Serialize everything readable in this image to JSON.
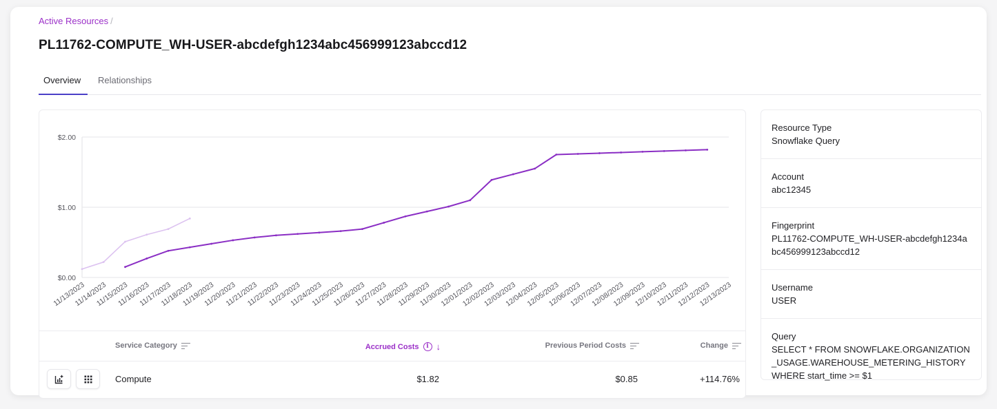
{
  "breadcrumb": {
    "parent": "Active Resources",
    "separator": "/"
  },
  "page_title": "PL11762-COMPUTE_WH-USER-abcdefgh1234abc456999123abccd12",
  "tabs": [
    {
      "label": "Overview",
      "active": true
    },
    {
      "label": "Relationships",
      "active": false
    }
  ],
  "colors": {
    "accent": "#9b30c8",
    "current_series": "#8a2ec4",
    "previous_series": "#dcc2f0",
    "tab_underline": "#4a3fc7"
  },
  "chart_data": {
    "type": "line",
    "title": "",
    "xlabel": "",
    "ylabel": "",
    "ylim": [
      0,
      2
    ],
    "yticks": [
      "$0.00",
      "$1.00",
      "$2.00"
    ],
    "ytick_values": [
      0,
      1,
      2
    ],
    "grid": true,
    "x": [
      "11/13/2023",
      "11/14/2023",
      "11/15/2023",
      "11/16/2023",
      "11/17/2023",
      "11/18/2023",
      "11/19/2023",
      "11/20/2023",
      "11/21/2023",
      "11/22/2023",
      "11/23/2023",
      "11/24/2023",
      "11/25/2023",
      "11/26/2023",
      "11/27/2023",
      "11/28/2023",
      "11/29/2023",
      "11/30/2023",
      "12/01/2023",
      "12/02/2023",
      "12/03/2023",
      "12/04/2023",
      "12/05/2023",
      "12/06/2023",
      "12/07/2023",
      "12/08/2023",
      "12/09/2023",
      "12/10/2023",
      "12/11/2023",
      "12/12/2023",
      "12/13/2023"
    ],
    "series": [
      {
        "name": "Previous Period Costs",
        "values": [
          0.12,
          0.22,
          0.51,
          0.61,
          0.69,
          0.84,
          null,
          null,
          null,
          null,
          null,
          null,
          null,
          null,
          null,
          null,
          null,
          null,
          null,
          null,
          null,
          null,
          null,
          null,
          null,
          null,
          null,
          null,
          null,
          null,
          null
        ]
      },
      {
        "name": "Accrued Costs",
        "values": [
          null,
          null,
          0.15,
          0.27,
          0.38,
          0.43,
          0.48,
          0.53,
          0.57,
          0.6,
          0.62,
          0.64,
          0.66,
          0.69,
          0.78,
          0.87,
          0.94,
          1.01,
          1.1,
          1.39,
          1.47,
          1.55,
          1.75,
          1.76,
          1.77,
          1.78,
          1.79,
          1.8,
          1.81,
          1.82,
          null
        ]
      }
    ]
  },
  "table": {
    "columns": [
      {
        "label": "Service Category",
        "sortable": true
      },
      {
        "label": "Accrued Costs",
        "sortable": true,
        "sorted": "desc",
        "info": true
      },
      {
        "label": "Previous Period Costs",
        "sortable": true
      },
      {
        "label": "Change",
        "sortable": true
      }
    ],
    "rows": [
      {
        "service": "Compute",
        "accrued": "$1.82",
        "previous": "$0.85",
        "change": "+114.76%"
      }
    ]
  },
  "details": [
    {
      "label": "Resource Type",
      "value": "Snowflake Query"
    },
    {
      "label": "Account",
      "value": "abc12345"
    },
    {
      "label": "Fingerprint",
      "value": "PL11762-COMPUTE_WH-USER-abcdefgh1234abc456999123abccd12"
    },
    {
      "label": "Username",
      "value": "USER"
    },
    {
      "label": "Query",
      "value": "SELECT * FROM SNOWFLAKE.ORGANIZATION_USAGE.WAREHOUSE_METERING_HISTORY WHERE start_time >= $1"
    }
  ]
}
